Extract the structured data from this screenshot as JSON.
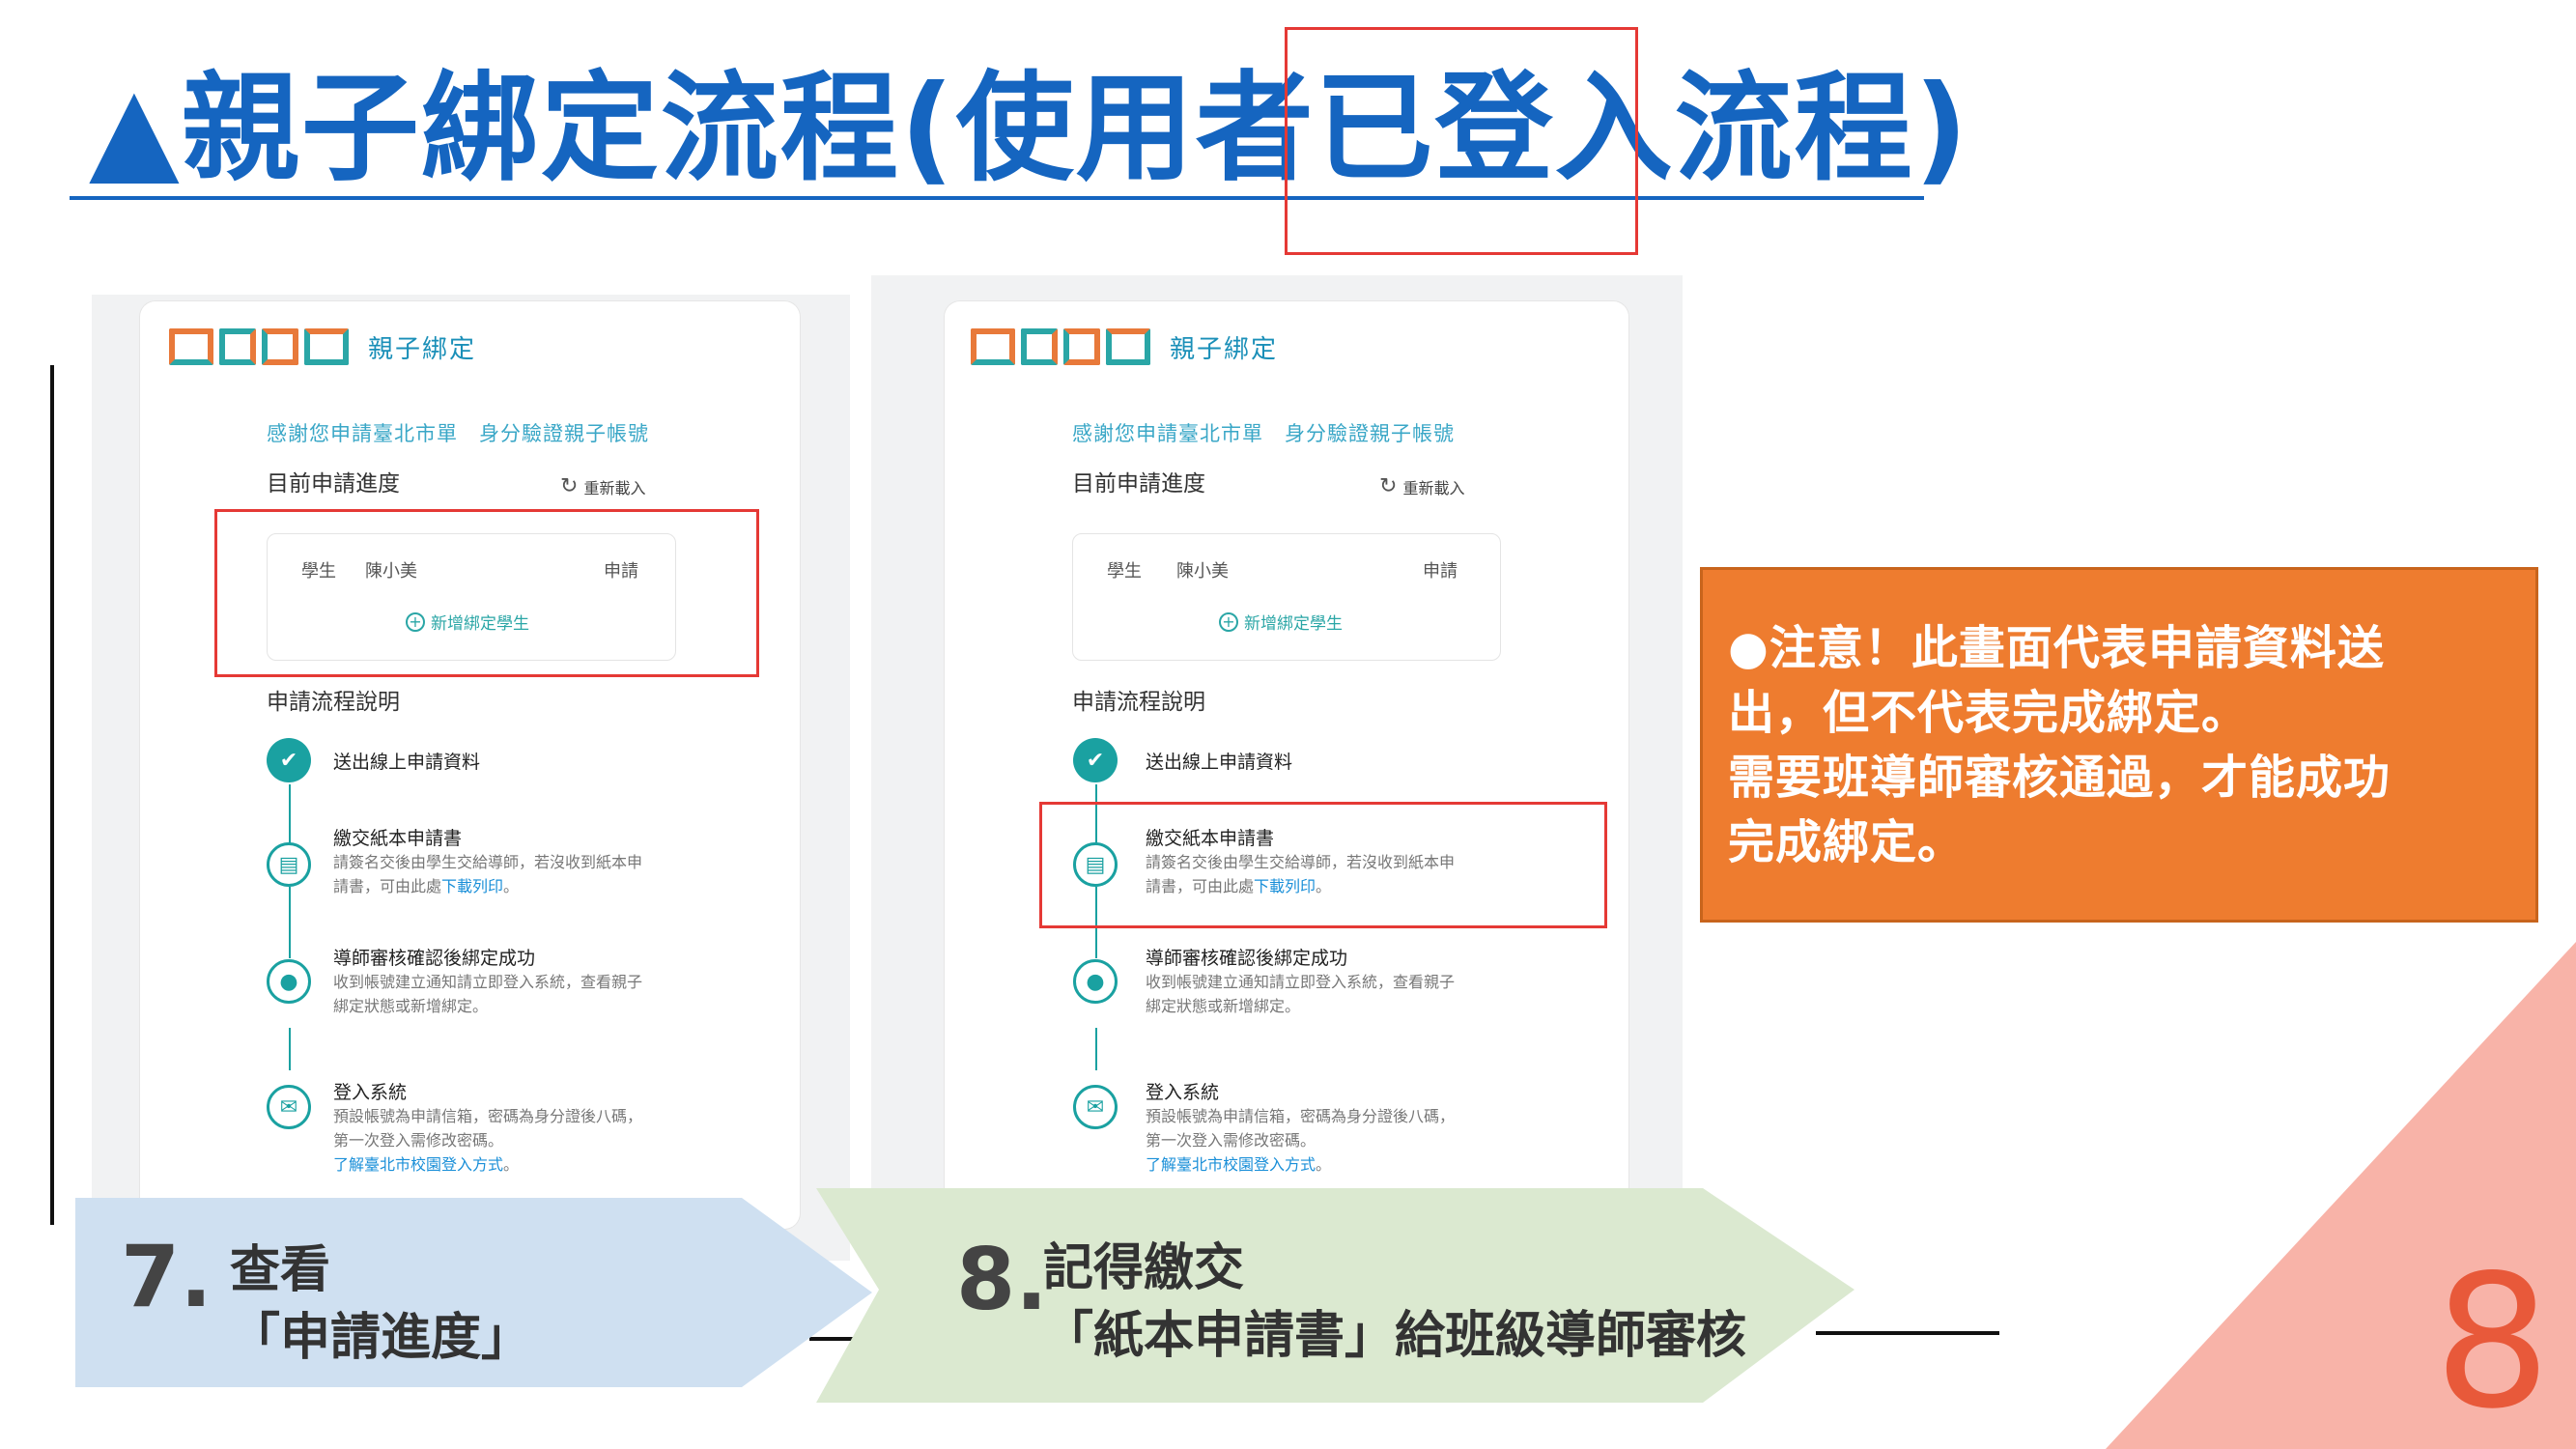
{
  "slide": {
    "title_part1": "▲親子綁定流程(使用者",
    "title_highlight": "已登入",
    "title_part2": "流程)",
    "page_number": "8"
  },
  "panels": [
    {
      "brand": "親子綁定",
      "thanks": "感謝您申請臺北市單　身分驗證親子帳號",
      "progress_label": "目前申請進度",
      "reload_label": "重新載入",
      "student_label": "學生",
      "student_name": "陳小美",
      "student_status": "申請",
      "add_student": "新增綁定學生",
      "flow_label": "申請流程說明",
      "steps": [
        {
          "title": "送出線上申請資料",
          "desc1": "",
          "desc2": "",
          "link": ""
        },
        {
          "title": "繳交紙本申請書",
          "desc1": "請簽名交後由學生交給導師，若沒收到紙本申",
          "desc2": "請書，可由此處",
          "link": "下載列印",
          "tail": "。"
        },
        {
          "title": "導師審核確認後綁定成功",
          "desc1": "收到帳號建立通知請立即登入系統，查看親子",
          "desc2": "綁定狀態或新增綁定。",
          "link": ""
        },
        {
          "title": "登入系統",
          "desc1": "預設帳號為申請信箱，密碼為身分證後八碼，",
          "desc2": "第一次登入需修改密碼。",
          "link": "了解臺北市校園登入方式",
          "tail": "。"
        }
      ]
    },
    {
      "brand": "親子綁定",
      "thanks": "感謝您申請臺北市單　身分驗證親子帳號",
      "progress_label": "目前申請進度",
      "reload_label": "重新載入",
      "student_label": "學生",
      "student_name": "陳小美",
      "student_status": "申請",
      "add_student": "新增綁定學生",
      "flow_label": "申請流程說明",
      "steps": [
        {
          "title": "送出線上申請資料",
          "desc1": "",
          "desc2": "",
          "link": ""
        },
        {
          "title": "繳交紙本申請書",
          "desc1": "請簽名交後由學生交給導師，若沒收到紙本申",
          "desc2": "請書，可由此處",
          "link": "下載列印",
          "tail": "。"
        },
        {
          "title": "導師審核確認後綁定成功",
          "desc1": "收到帳號建立通知請立即登入系統，查看親子",
          "desc2": "綁定狀態或新增綁定。",
          "link": ""
        },
        {
          "title": "登入系統",
          "desc1": "預設帳號為申請信箱，密碼為身分證後八碼，",
          "desc2": "第一次登入需修改密碼。",
          "link": "了解臺北市校園登入方式",
          "tail": "。"
        }
      ]
    }
  ],
  "notice": {
    "line1": "●注意！此畫面代表申請資料送",
    "line2": "出，但不代表完成綁定。",
    "line3": "需要班導師審核通過，才能成功",
    "line4": "完成綁定。"
  },
  "callouts": [
    {
      "number": "7.",
      "line1": "查看",
      "line2": "「申請進度」",
      "color": "#cfe0f1"
    },
    {
      "number": "8.",
      "line1": "記得繳交",
      "line2": "「紙本申請書」給班級導師審核",
      "color": "#dbe9d0"
    }
  ],
  "colors": {
    "title": "#1565c0",
    "highlight_box": "#e53935",
    "notice_bg": "#ee7c2f",
    "triangle": "#f8b3a8",
    "page_number": "#e8593a",
    "logo": [
      "#e8793a",
      "#2aa6a6",
      "#e8793a",
      "#2aa6a6",
      "#e8793a"
    ]
  }
}
